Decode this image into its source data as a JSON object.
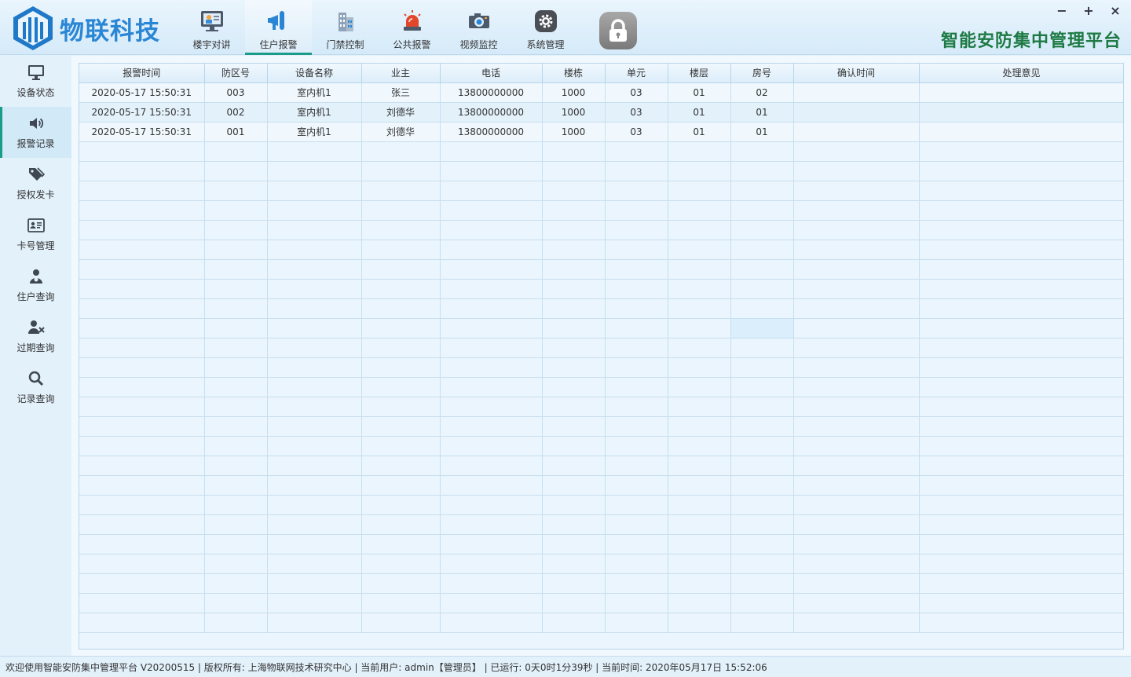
{
  "app": {
    "logo_text": "物联科技",
    "platform_title": "智能安防集中管理平台",
    "window_controls": {
      "minimize": "−",
      "maximize": "+",
      "close": "×"
    }
  },
  "nav": {
    "items": [
      {
        "label": "楼宇对讲",
        "icon": "monitor-person-icon"
      },
      {
        "label": "住户报警",
        "icon": "megaphone-icon",
        "active": true
      },
      {
        "label": "门禁控制",
        "icon": "building-icon"
      },
      {
        "label": "公共报警",
        "icon": "siren-icon"
      },
      {
        "label": "视频监控",
        "icon": "camera-icon"
      },
      {
        "label": "系统管理",
        "icon": "gear-icon"
      }
    ],
    "lock_icon": "lock-icon"
  },
  "sidebar": {
    "items": [
      {
        "label": "设备状态",
        "icon": "monitor-icon"
      },
      {
        "label": "报警记录",
        "icon": "speaker-icon",
        "active": true
      },
      {
        "label": "授权发卡",
        "icon": "tags-icon"
      },
      {
        "label": "卡号管理",
        "icon": "id-card-icon"
      },
      {
        "label": "住户查询",
        "icon": "user-search-icon"
      },
      {
        "label": "过期查询",
        "icon": "user-x-icon"
      },
      {
        "label": "记录查询",
        "icon": "search-icon"
      }
    ]
  },
  "table": {
    "columns": [
      "报警时间",
      "防区号",
      "设备名称",
      "业主",
      "电话",
      "楼栋",
      "单元",
      "楼层",
      "房号",
      "确认时间",
      "处理意见"
    ],
    "rows": [
      [
        "2020-05-17 15:50:31",
        "003",
        "室内机1",
        "张三",
        "13800000000",
        "1000",
        "03",
        "01",
        "02",
        "",
        ""
      ],
      [
        "2020-05-17 15:50:31",
        "002",
        "室内机1",
        "刘德华",
        "13800000000",
        "1000",
        "03",
        "01",
        "01",
        "",
        ""
      ],
      [
        "2020-05-17 15:50:31",
        "001",
        "室内机1",
        "刘德华",
        "13800000000",
        "1000",
        "03",
        "01",
        "01",
        "",
        ""
      ]
    ]
  },
  "status_bar": {
    "text": "欢迎使用智能安防集中管理平台 V20200515 | 版权所有: 上海物联网技术研究中心 | 当前用户: admin【管理员】 | 已运行: 0天0时1分39秒 | 当前时间: 2020年05月17日 15:52:06"
  },
  "colors": {
    "accent": "#1b9c8a",
    "brand": "#2a86d4",
    "title_green": "#1d7a44"
  }
}
